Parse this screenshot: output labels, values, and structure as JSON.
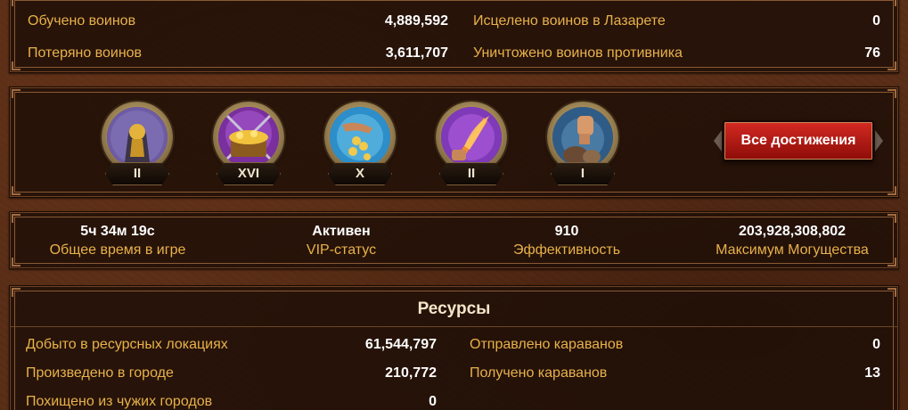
{
  "combat_stats": {
    "trained_label": "Обучено воинов",
    "trained_value": "4,889,592",
    "lost_label": "Потеряно воинов",
    "lost_value": "3,611,707",
    "healed_label": "Исцелено воинов в Лазарете",
    "healed_value": "0",
    "destroyed_label": "Уничтожено воинов противника",
    "destroyed_value": "76"
  },
  "achievements": {
    "badges": [
      {
        "icon": "golden-hooded-figure-icon",
        "level": "II",
        "color": "#6d5ba3"
      },
      {
        "icon": "treasure-chest-icon",
        "level": "XVI",
        "color": "#7a2f9e"
      },
      {
        "icon": "hand-coins-icon",
        "level": "X",
        "color": "#2d8ec9"
      },
      {
        "icon": "fire-sword-icon",
        "level": "II",
        "color": "#7e3ab8"
      },
      {
        "icon": "raised-fist-icon",
        "level": "I",
        "color": "#2f5c86"
      }
    ],
    "all_button_label": "Все достижения"
  },
  "profile_stats": {
    "playtime_value": "5ч 34м 19с",
    "playtime_label": "Общее время в игре",
    "vip_value": "Активен",
    "vip_label": "VIP-статус",
    "efficiency_value": "910",
    "efficiency_label": "Эффективность",
    "max_power_value": "203,928,308,802",
    "max_power_label": "Максимум Могущества"
  },
  "resources": {
    "title": "Ресурсы",
    "mined_label": "Добыто в ресурсных локациях",
    "mined_value": "61,544,797",
    "produced_label": "Произведено в городе",
    "produced_value": "210,772",
    "stolen_label": "Похищено из чужих городов",
    "stolen_value": "0",
    "sent_label": "Отправлено караванов",
    "sent_value": "0",
    "received_label": "Получено караванов",
    "received_value": "13"
  }
}
